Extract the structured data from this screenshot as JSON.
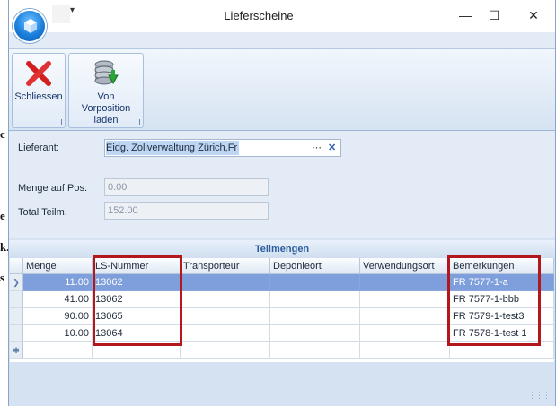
{
  "window": {
    "title": "Lieferscheine"
  },
  "ribbon": {
    "buttons": [
      {
        "label": "Schliessen",
        "icon": "close-x-icon"
      },
      {
        "label": "Von Vorposition laden",
        "icon": "database-download-icon"
      }
    ]
  },
  "form": {
    "lieferant_label": "Lieferant:",
    "lieferant_value": "Eidg. Zollverwaltung Zürich,Fr",
    "menge_label": "Menge auf Pos.",
    "menge_value": "0.00",
    "total_label": "Total Teilm.",
    "total_value": "152.00"
  },
  "grid": {
    "title": "Teilmengen",
    "columns": [
      "Menge",
      "LS-Nummer",
      "Transporteur",
      "Deponieort",
      "Verwendungsort",
      "Bemerkungen"
    ],
    "rows": [
      {
        "menge": "11.00",
        "ls": "13062",
        "transporteur": "",
        "deponieort": "",
        "verwendungsort": "",
        "bemerkungen": "FR 7577-1-a"
      },
      {
        "menge": "41.00",
        "ls": "13062",
        "transporteur": "",
        "deponieort": "",
        "verwendungsort": "",
        "bemerkungen": "FR 7577-1-bbb"
      },
      {
        "menge": "90.00",
        "ls": "13065",
        "transporteur": "",
        "deponieort": "",
        "verwendungsort": "",
        "bemerkungen": "FR 7579-1-test3"
      },
      {
        "menge": "10.00",
        "ls": "13064",
        "transporteur": "",
        "deponieort": "",
        "verwendungsort": "",
        "bemerkungen": "FR 7578-1-test 1"
      }
    ]
  },
  "background_fragments": [
    "c",
    "e",
    "k.",
    "s"
  ],
  "colors": {
    "highlight": "#b3171c",
    "selected_row": "#7e9fdb",
    "accent": "#2c5e9c"
  }
}
